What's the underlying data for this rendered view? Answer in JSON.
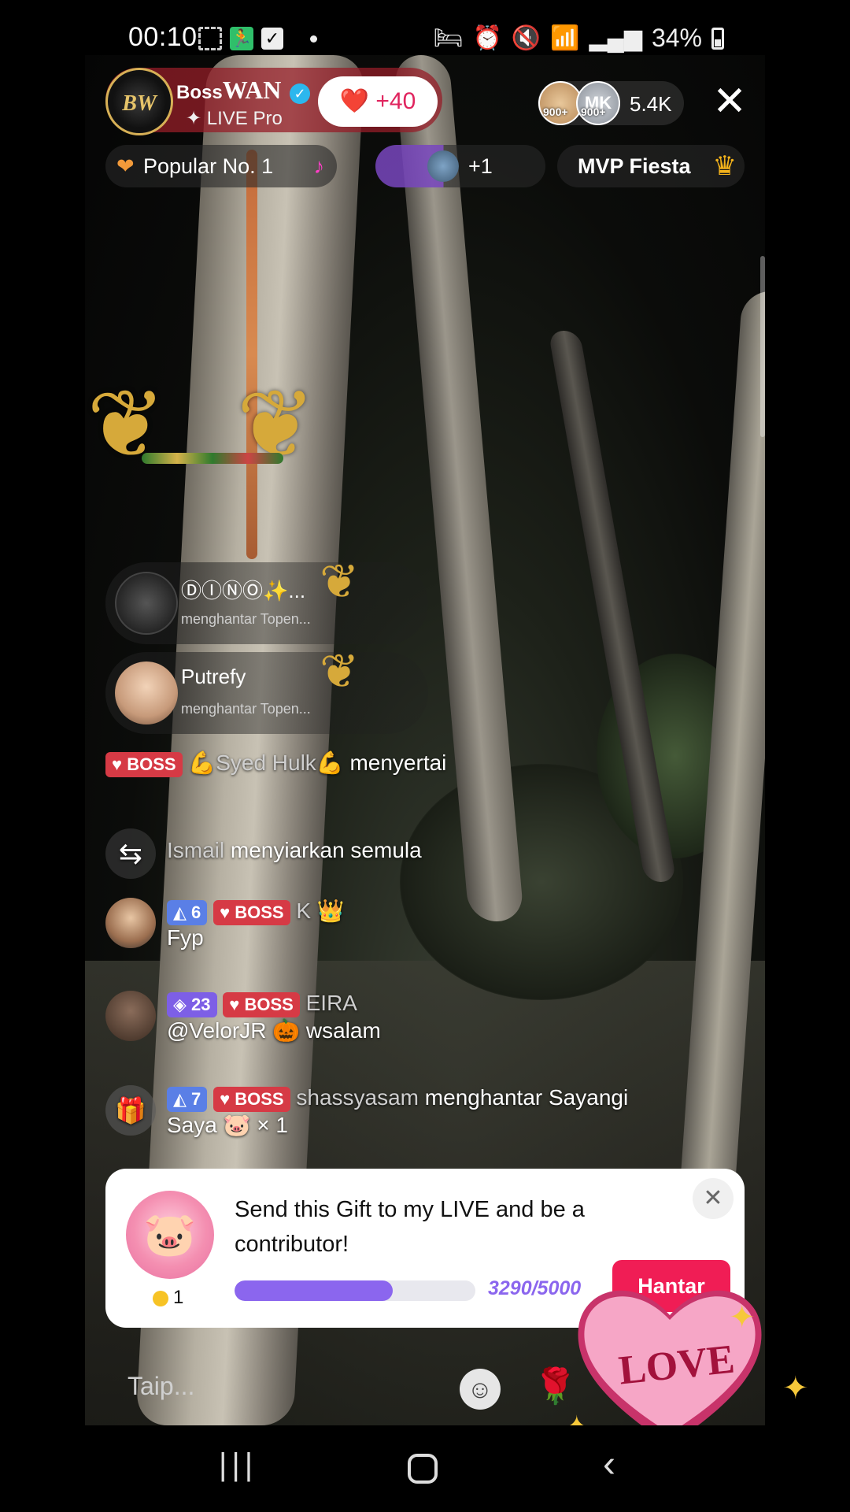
{
  "status_bar": {
    "time": "00:10",
    "battery": "34%"
  },
  "host": {
    "name_prefix": "Boss",
    "name_main": "WAN",
    "subtitle": "LIVE Pro",
    "likes": "+40"
  },
  "viewers": {
    "badge_1": "900+",
    "avatar_2_initials": "MK",
    "badge_2": "900+",
    "count": "5.4K"
  },
  "chips": {
    "popular": "Popular No. 1",
    "plus": "+1",
    "mvp": "MVP Fiesta"
  },
  "gift_notices": [
    {
      "name": "ⒹⒾⓃⓄ✨...",
      "subtitle": "menghantar Topen..."
    },
    {
      "name": "Putrefy",
      "subtitle": "menghantar Topen..."
    }
  ],
  "chat": {
    "join": {
      "badge": "BOSS",
      "user": "💪Syed Hulk💪",
      "text": "menyertai"
    },
    "rebroadcast": {
      "user": "Ismail",
      "text": "menyiarkan semula"
    },
    "fyp": {
      "level": "6",
      "badge": "BOSS",
      "user": "K 👑",
      "text": "Fyp"
    },
    "eira": {
      "level": "23",
      "badge": "BOSS",
      "user": "EIRA",
      "text": "@VelorJR 🎃 wsalam"
    },
    "gift": {
      "level": "7",
      "badge": "BOSS",
      "user": "shassyasam",
      "text": "menghantar Sayangi",
      "text2": "Saya 🐷 × 1"
    }
  },
  "gift_card": {
    "title": "Send this Gift to my LIVE and be a contributor!",
    "coins": "1",
    "progress_text": "3290/5000",
    "progress_fraction": 0.658,
    "button": "Hantar"
  },
  "input": {
    "placeholder": "Taip..."
  },
  "sticker": {
    "text": "LOVE"
  },
  "colors": {
    "accent_red": "#f01d55",
    "progress_purple": "#8b66ee",
    "boss_badge": "#d63a45"
  }
}
